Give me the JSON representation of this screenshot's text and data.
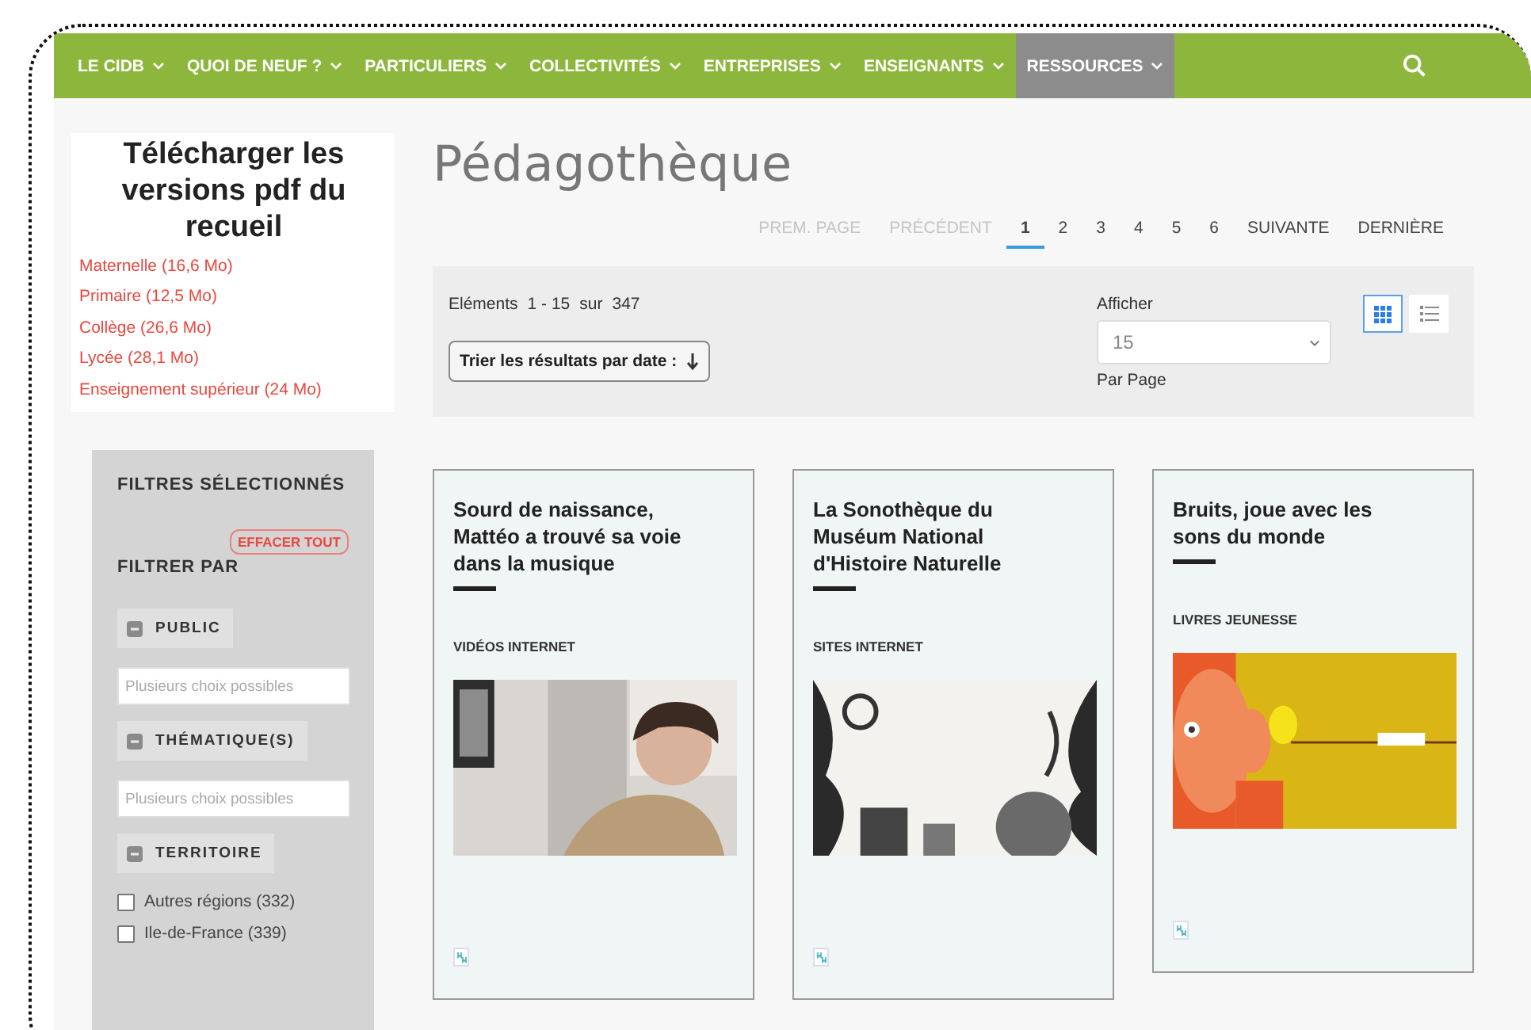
{
  "nav": {
    "items": [
      {
        "label": "LE CIDB",
        "selected": false
      },
      {
        "label": "QUOI DE NEUF ?",
        "selected": false
      },
      {
        "label": "PARTICULIERS",
        "selected": false
      },
      {
        "label": "COLLECTIVITÉS",
        "selected": false
      },
      {
        "label": "ENTREPRISES",
        "selected": false
      },
      {
        "label": "ENSEIGNANTS",
        "selected": false
      },
      {
        "label": "RESSOURCES",
        "selected": true
      }
    ]
  },
  "downloads": {
    "title": "Télécharger les versions pdf du recueil",
    "links": [
      "Maternelle (16,6 Mo)",
      "Primaire (12,5 Mo)",
      "Collège (26,6 Mo)",
      "Lycée (28,1 Mo)",
      "Enseignement supérieur (24 Mo)"
    ]
  },
  "filters": {
    "selected_heading": "FILTRES SÉLECTIONNÉS",
    "clear_button": "EFFACER TOUT",
    "filter_by_heading": "FILTRER PAR",
    "groups": [
      {
        "label": "PUBLIC",
        "expanded": true,
        "kind": "field",
        "placeholder": "Plusieurs choix possibles"
      },
      {
        "label": "THÉMATIQUE(S)",
        "expanded": true,
        "kind": "field",
        "placeholder": "Plusieurs choix possibles"
      },
      {
        "label": "TERRITOIRE",
        "expanded": true,
        "kind": "checkboxes",
        "options": [
          {
            "label": "Autres régions (332)",
            "checked": false
          },
          {
            "label": "Ile-de-France (339)",
            "checked": false
          }
        ]
      }
    ]
  },
  "page_title": "Pédagothèque",
  "pagination": [
    {
      "label": "PREM. PAGE",
      "disabled": true,
      "selected": false
    },
    {
      "label": "PRÉCÉDENT",
      "disabled": true,
      "selected": false
    },
    {
      "label": "1",
      "disabled": false,
      "selected": true
    },
    {
      "label": "2",
      "disabled": false,
      "selected": false
    },
    {
      "label": "3",
      "disabled": false,
      "selected": false
    },
    {
      "label": "4",
      "disabled": false,
      "selected": false
    },
    {
      "label": "5",
      "disabled": false,
      "selected": false
    },
    {
      "label": "6",
      "disabled": false,
      "selected": false
    },
    {
      "label": "SUIVANTE",
      "disabled": false,
      "selected": false
    },
    {
      "label": "DERNIÈRE",
      "disabled": false,
      "selected": false
    }
  ],
  "toolbar": {
    "elements_label": "Eléments",
    "range": "1 - 15",
    "of": "sur",
    "total": "347",
    "sort_button": "Trier les résultats par date :",
    "per_page_label": "Afficher",
    "per_page_value": "15",
    "per_page_suffix": "Par Page",
    "views": [
      {
        "kind": "grid",
        "selected": true
      },
      {
        "kind": "list",
        "selected": false
      }
    ]
  },
  "cards": [
    {
      "title": "Sourd de naissance, Mattéo a trouvé sa voie dans la musique",
      "category": "VIDÉOS INTERNET"
    },
    {
      "title": "La Sonothèque du Muséum National d'Histoire Naturelle",
      "category": "SITES INTERNET"
    },
    {
      "title": "Bruits, joue avec les sons du monde",
      "category": "LIVRES JEUNESSE"
    }
  ]
}
